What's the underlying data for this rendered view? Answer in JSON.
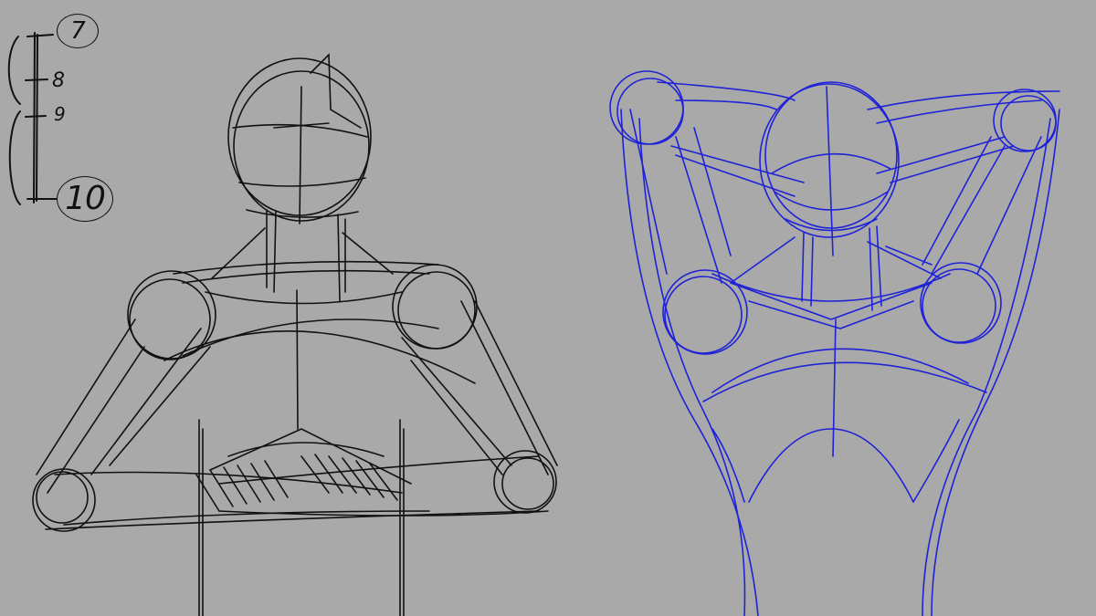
{
  "canvas": {
    "background": "#a9a9a9",
    "stroke_colors": {
      "black_sketch": "#111111",
      "blue_sketch": "#1f22d6"
    }
  },
  "proportion_labels": {
    "seven": "7",
    "eight": "8",
    "nine": "9",
    "ten": "10"
  }
}
